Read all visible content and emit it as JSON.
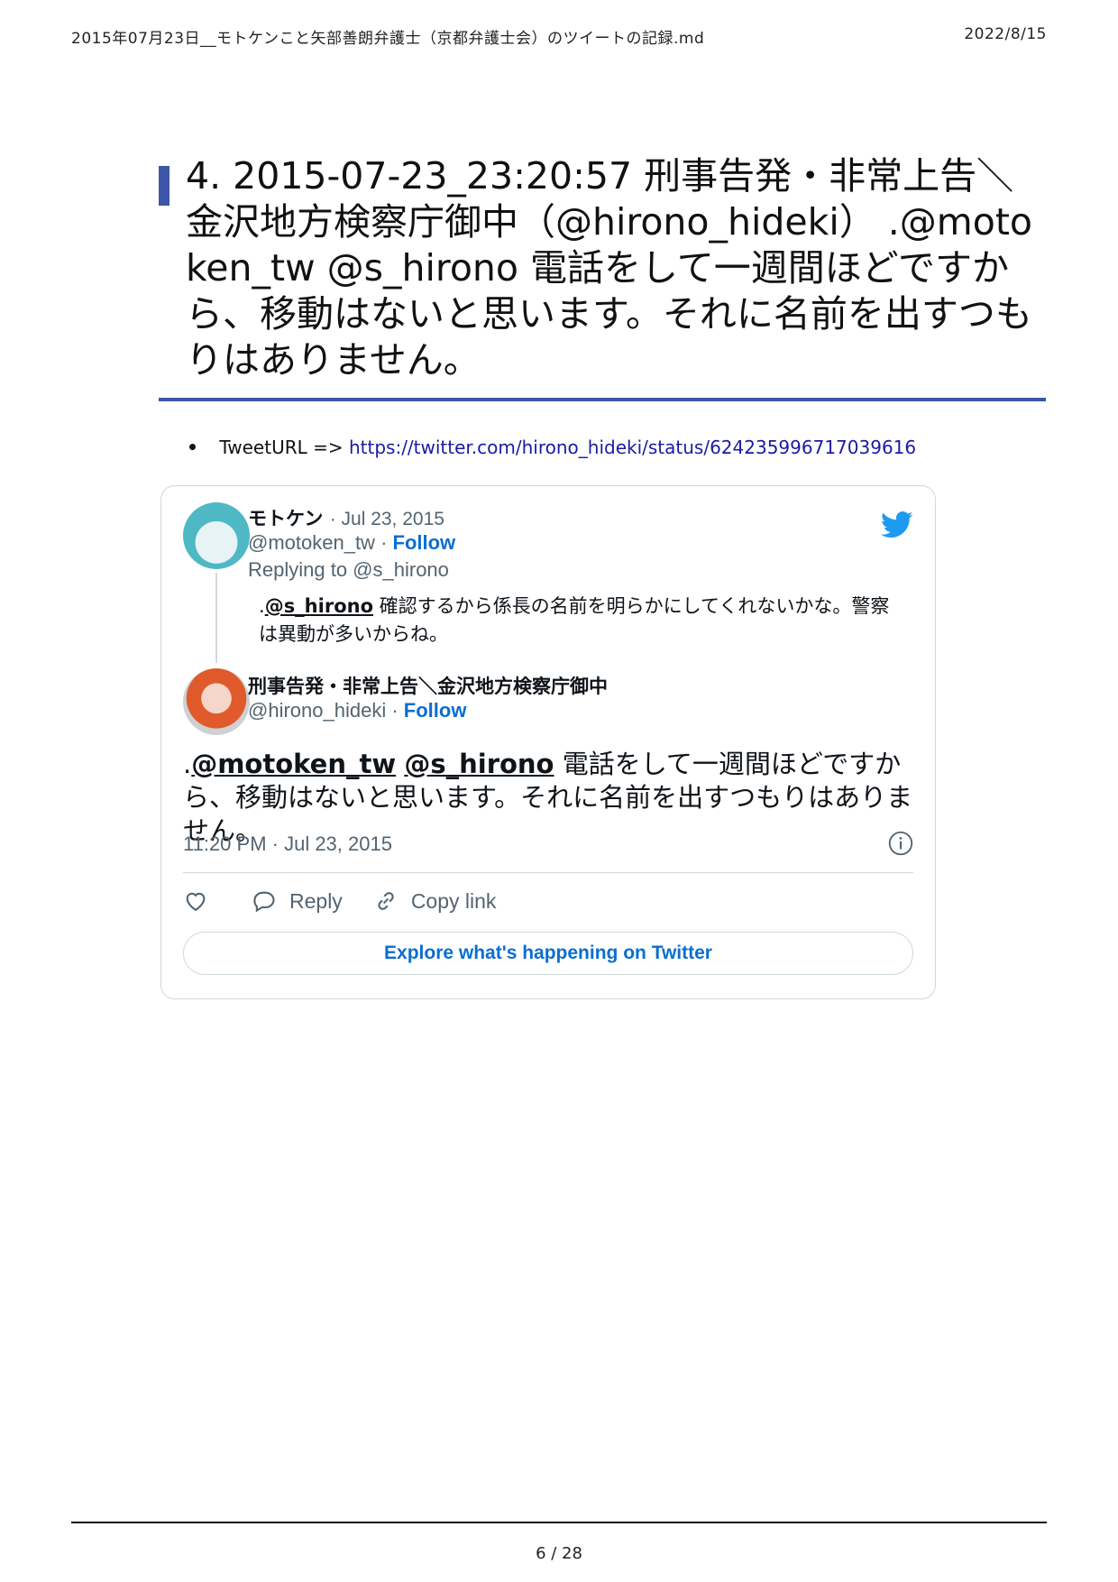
{
  "header": {
    "document_title": "2015年07月23日__モトケンこと矢部善朗弁護士（京都弁護士会）のツイートの記録.md",
    "date": "2022/8/15"
  },
  "heading": {
    "text": "4. 2015-07-23_23:20:57 刑事告発・非常上告＼金沢地方検察庁御中（@hirono_hideki） .@motoken_tw @s_hirono 電話をして一週間ほどですから、移動はないと思います。それに名前を出すつもりはありません。"
  },
  "bullet": {
    "label": "TweetURL =>",
    "url": "https://twitter.com/hirono_hideki/status/624235996717039616"
  },
  "tweet": {
    "reply": {
      "name": "モトケン",
      "date": "· Jul 23, 2015",
      "handle": "@motoken_tw",
      "sep": " · ",
      "follow": "Follow",
      "replying_to": "Replying to @s_hirono",
      "text_prefix": ".",
      "mention": "@s_hirono",
      "text_body": " 確認するから係長の名前を明らかにしてくれないかな。警察は異動が多いからね。"
    },
    "main": {
      "name": "刑事告発・非常上告＼金沢地方検察庁御中",
      "handle": "@hirono_hideki",
      "sep": " · ",
      "follow": "Follow",
      "text_prefix": ".",
      "mention1": "@motoken_tw",
      "mention2": "@s_hirono",
      "text_body": " 電話をして一週間ほどですから、移動はないと思います。それに名前を出すつもりはありません。",
      "timestamp": "11:20 PM · Jul 23, 2015"
    },
    "actions": {
      "reply": "Reply",
      "copy_link": "Copy link"
    },
    "explore": "Explore what's happening on Twitter",
    "colors": {
      "link": "#0a6ed1",
      "muted": "#536471",
      "twitter_blue": "#1d9bf0"
    }
  },
  "footer": {
    "page": "6 / 28"
  }
}
